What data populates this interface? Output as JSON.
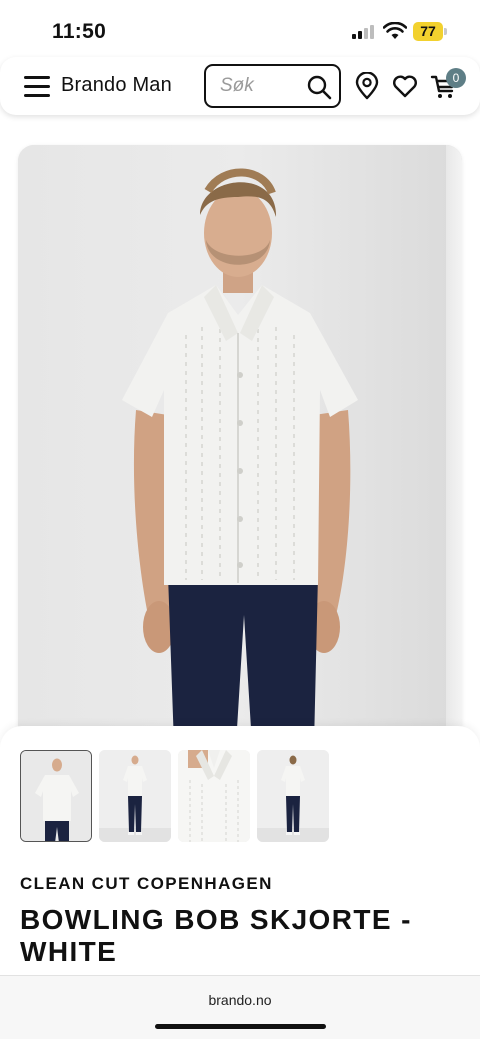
{
  "status_bar": {
    "time": "11:50",
    "battery": "77"
  },
  "header": {
    "brand": "Brando Man",
    "search_placeholder": "Søk",
    "cart_count": "0",
    "icons": [
      "menu-icon",
      "search-icon",
      "location-pin-icon",
      "heart-icon",
      "cart-icon"
    ]
  },
  "product": {
    "brand": "CLEAN CUT COPENHAGEN",
    "title": "BOWLING BOB SKJORTE - WHITE",
    "thumbnails_count": 4
  },
  "browser": {
    "url": "brando.no"
  },
  "colors": {
    "cart_badge": "#5e7e86",
    "battery": "#f2d12e",
    "shirt": "#f2f2f0",
    "trousers": "#1b2340"
  }
}
